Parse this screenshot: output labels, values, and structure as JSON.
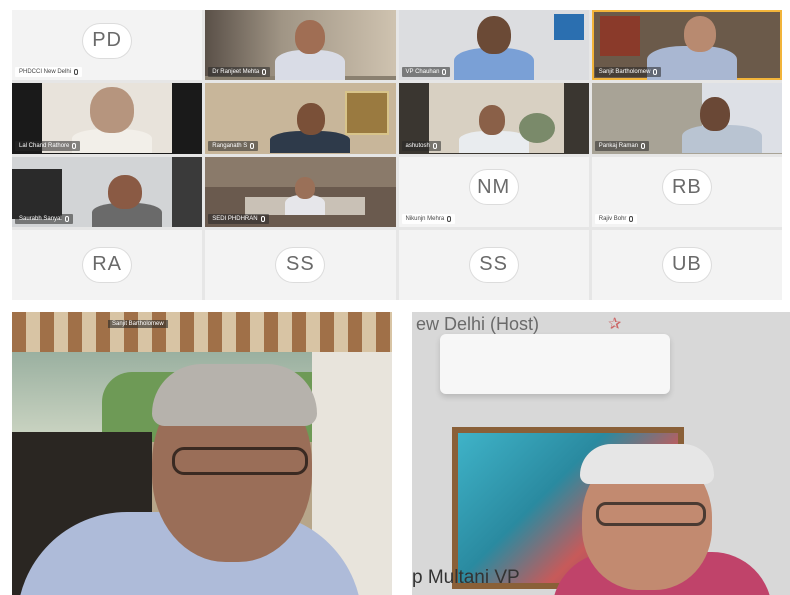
{
  "tiles": [
    {
      "initials": "PD",
      "name": "PHDCCI New Delhi",
      "video": false
    },
    {
      "initials": "",
      "name": "Dr Ranjeet Mehta",
      "video": true
    },
    {
      "initials": "",
      "name": "VP Chauhan",
      "video": true
    },
    {
      "initials": "",
      "name": "Sanjit Bartholomew",
      "video": true
    },
    {
      "initials": "",
      "name": "Lal Chand Rathore",
      "video": true
    },
    {
      "initials": "",
      "name": "Ranganath S",
      "video": true
    },
    {
      "initials": "",
      "name": "ashutosh",
      "video": true
    },
    {
      "initials": "",
      "name": "Pankaj Raman",
      "video": true
    },
    {
      "initials": "",
      "name": "Saurabh Sanyal",
      "video": true
    },
    {
      "initials": "",
      "name": "SEDI PHDHRAN",
      "video": true
    },
    {
      "initials": "NM",
      "name": "Nikunjn Mehra",
      "video": false
    },
    {
      "initials": "RB",
      "name": "Rajiv Bohr",
      "video": false
    },
    {
      "initials": "RA",
      "name": "",
      "video": false
    },
    {
      "initials": "SS",
      "name": "",
      "video": false
    },
    {
      "initials": "SS",
      "name": "",
      "video": false
    },
    {
      "initials": "UB",
      "name": "",
      "video": false
    }
  ],
  "speakers": {
    "left": {
      "small_label": "Sanjit Bartholomew"
    },
    "right": {
      "host_label": "ew Delhi (Host)",
      "vp_label": "p Multani VP"
    }
  }
}
